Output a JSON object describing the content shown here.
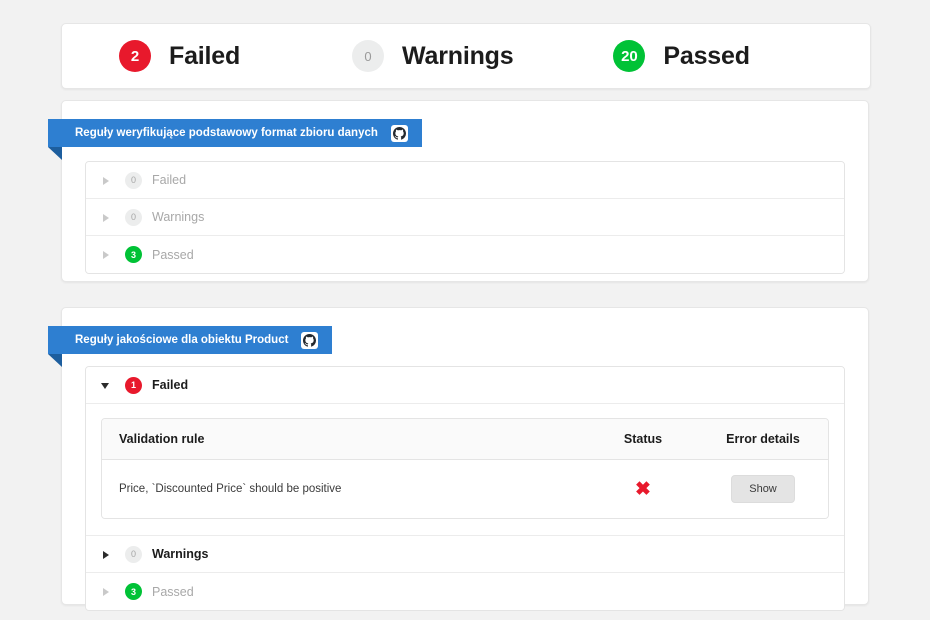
{
  "summary": {
    "items": [
      {
        "count": "2",
        "label": "Failed",
        "color": "#e8192c",
        "style": "red"
      },
      {
        "count": "0",
        "label": "Warnings",
        "color": "#eceded",
        "style": "grey"
      },
      {
        "count": "20",
        "label": "Passed",
        "color": "#00c236",
        "style": "green"
      }
    ]
  },
  "sections": [
    {
      "ribbon_title": "Reguły weryfikujące podstawowy format zbioru danych",
      "ribbon_icon": "github-icon",
      "rows": [
        {
          "count": "0",
          "label": "Failed",
          "state": "muted",
          "expanded": false
        },
        {
          "count": "0",
          "label": "Warnings",
          "state": "muted",
          "expanded": false
        },
        {
          "count": "3",
          "label": "Passed",
          "state": "muted",
          "expanded": false
        }
      ]
    },
    {
      "ribbon_title": "Reguły jakościowe dla obiektu Product",
      "ribbon_icon": "github-icon",
      "rows": [
        {
          "count": "1",
          "label": "Failed",
          "state": "active",
          "expanded": true
        },
        {
          "count": "0",
          "label": "Warnings",
          "state": "active",
          "expanded": false
        },
        {
          "count": "3",
          "label": "Passed",
          "state": "muted",
          "expanded": false
        }
      ],
      "table": {
        "headers": {
          "rule": "Validation rule",
          "status": "Status",
          "error_details": "Error details"
        },
        "rows": [
          {
            "rule": "Price, `Discounted Price` should be positive",
            "status_icon": "red-cross-icon",
            "status_symbol": "✖",
            "action_label": "Show"
          }
        ]
      }
    }
  ]
}
